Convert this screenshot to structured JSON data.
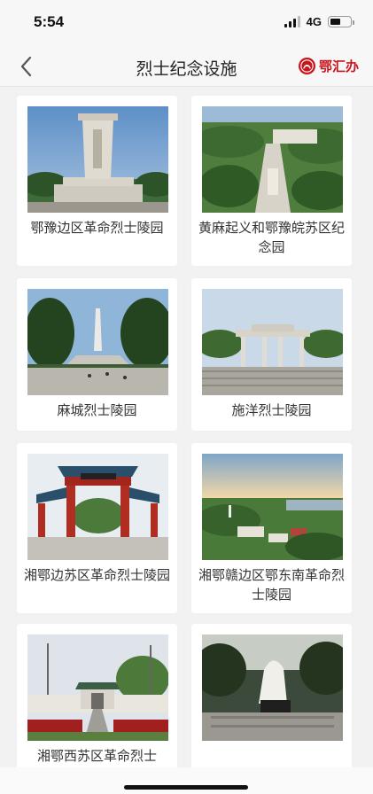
{
  "status_bar": {
    "time": "5:54",
    "network": "4G"
  },
  "nav": {
    "title": "烈士纪念设施",
    "brand": "鄂汇办"
  },
  "cards": [
    {
      "title": "鄂豫边区革命烈士陵园",
      "image": "monument-obelisk-photo"
    },
    {
      "title": "黄麻起义和鄂豫皖苏区纪念园",
      "image": "memorial-park-aerial-photo"
    },
    {
      "title": "麻城烈士陵园",
      "image": "obelisk-avenue-photo"
    },
    {
      "title": "施洋烈士陵园",
      "image": "stone-archway-photo"
    },
    {
      "title": "湘鄂边苏区革命烈士陵园",
      "image": "red-gate-photo"
    },
    {
      "title": "湘鄂赣边区鄂东南革命烈士陵园",
      "image": "hillside-aerial-photo"
    },
    {
      "title": "湘鄂西苏区革命烈士",
      "image": "gate-road-photo"
    },
    {
      "title": "",
      "image": "white-statue-photo"
    }
  ]
}
